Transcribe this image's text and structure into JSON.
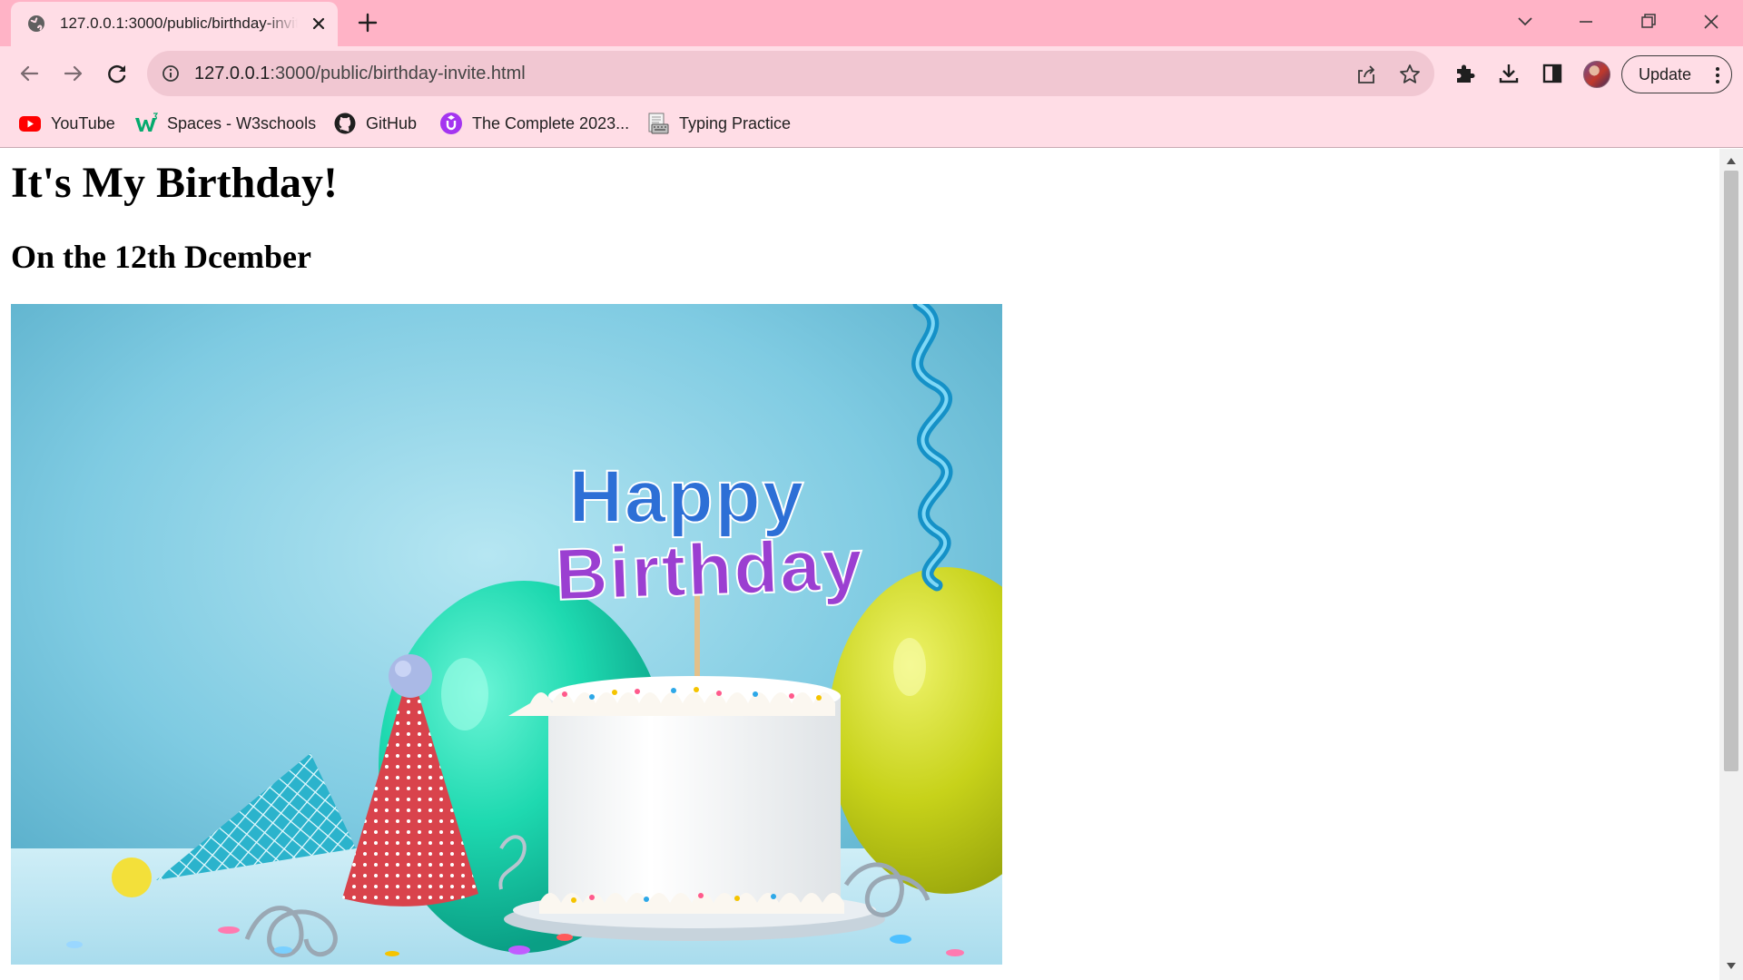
{
  "browser": {
    "tab": {
      "title": "127.0.0.1:3000/public/birthday-invite.html",
      "favicon": "globe-icon",
      "close_icon": "close-icon"
    },
    "new_tab_icon": "plus-icon",
    "window_controls": [
      "chevron-down-icon",
      "minimize-icon",
      "restore-icon",
      "close-icon"
    ],
    "address_bar": {
      "host": "127.0.0.1",
      "path": ":3000/public/birthday-invite.html",
      "info_icon": "info-icon",
      "share_icon": "share-icon",
      "bookmark_icon": "star-icon"
    },
    "nav_icons": [
      "back-arrow-icon",
      "forward-arrow-icon",
      "reload-icon"
    ],
    "toolbar_icons": [
      "extensions-puzzle-icon",
      "download-icon",
      "side-panel-icon"
    ],
    "update_button": {
      "label": "Update",
      "menu_icon": "more-vert-icon"
    },
    "bookmarks": [
      {
        "label": "YouTube",
        "icon": "youtube-icon"
      },
      {
        "label": "Spaces - W3schools",
        "icon": "w3schools-icon"
      },
      {
        "label": "GitHub",
        "icon": "github-icon"
      },
      {
        "label": "The Complete 2023...",
        "icon": "udemy-icon"
      },
      {
        "label": "Typing Practice",
        "icon": "keyboard-icon"
      }
    ],
    "colors": {
      "tab_strip": "#ffb3c6",
      "toolbar": "#ffdde6",
      "omnibox": "#f1c7d2"
    }
  },
  "page": {
    "heading": "It's My Birthday!",
    "subheading": "On the 12th Dcember",
    "hero_image": {
      "topper_line1": "Happy",
      "topper_line2": "Birthday"
    }
  }
}
